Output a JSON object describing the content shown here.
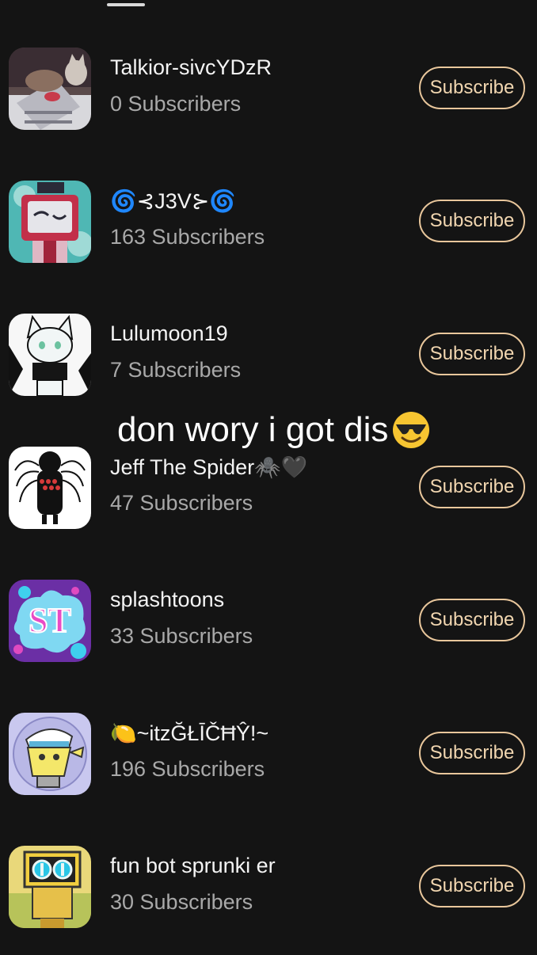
{
  "channels": [
    {
      "name": "Talkior-sivcYDzR",
      "subscribers": "0 Subscribers",
      "button": "Subscribe",
      "avatar_icon": "cat-photo-avatar"
    },
    {
      "name": "🌀⊰J3V⊱🌀",
      "subscribers": "163 Subscribers",
      "button": "Subscribe",
      "avatar_icon": "tv-head-avatar"
    },
    {
      "name": "Lulumoon19",
      "subscribers": "7 Subscribers",
      "button": "Subscribe",
      "avatar_icon": "white-cat-avatar"
    },
    {
      "name": "Jeff The Spider🕷️🖤",
      "subscribers": "47 Subscribers",
      "button": "Subscribe",
      "avatar_icon": "spider-avatar"
    },
    {
      "name": "splashtoons",
      "subscribers": "33 Subscribers",
      "button": "Subscribe",
      "avatar_icon": "st-splash-avatar"
    },
    {
      "name": "🍋~itzĞŁĪČĦŶ!~",
      "subscribers": "196 Subscribers",
      "button": "Subscribe",
      "avatar_icon": "lemon-character-avatar"
    },
    {
      "name": "fun bot sprunki er",
      "subscribers": "30 Subscribers",
      "button": "Subscribe",
      "avatar_icon": "robot-avatar"
    }
  ],
  "overlay_text": "don wory i got dis",
  "overlay_emoji": "sunglasses-face-icon",
  "colors": {
    "background": "#141414",
    "button_border": "#e9c79c",
    "button_text": "#f1d6b0",
    "subscriber_text": "#a9a9a9"
  }
}
